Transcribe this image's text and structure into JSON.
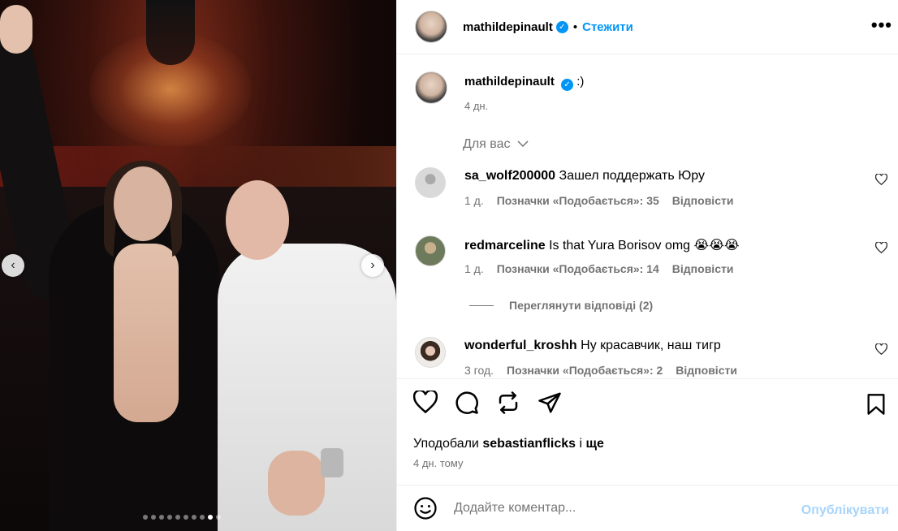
{
  "post": {
    "author": "mathildepinault",
    "follow_label": "Стежити",
    "more_label": "•••",
    "caption_text": ":)",
    "caption_time": "4 дн.",
    "sort_label": "Для вас",
    "likes_prefix": "Уподобали",
    "likes_user": "sebastianflicks",
    "likes_and": "і",
    "likes_more": "ще",
    "post_time": "4 дн. тому"
  },
  "carousel": {
    "slide_count": 10,
    "active_slide": 8,
    "prev_label": "‹",
    "next_label": "›"
  },
  "comments": [
    {
      "user": "sa_wolf200000",
      "text": "Зашел поддержать Юру",
      "time": "1 д.",
      "likes": "Позначки «Подобається»: 35",
      "reply": "Відповісти"
    },
    {
      "user": "redmarceline",
      "text": "Is that Yura Borisov omg 😭😭😭",
      "time": "1 д.",
      "likes": "Позначки «Подобається»: 14",
      "reply": "Відповісти"
    },
    {
      "user": "wonderful_kroshh",
      "text": "Ну красавчик, наш тигр",
      "time": "3 год.",
      "likes": "Позначки «Подобається»: 2",
      "reply": "Відповісти"
    }
  ],
  "view_replies_label": "Переглянути відповіді (2)",
  "add_comment": {
    "placeholder": "Додайте коментар...",
    "publish_label": "Опублікувати"
  },
  "colors": {
    "accent": "#0095f6",
    "muted": "#737373",
    "publish_disabled": "#a7d4fb"
  }
}
